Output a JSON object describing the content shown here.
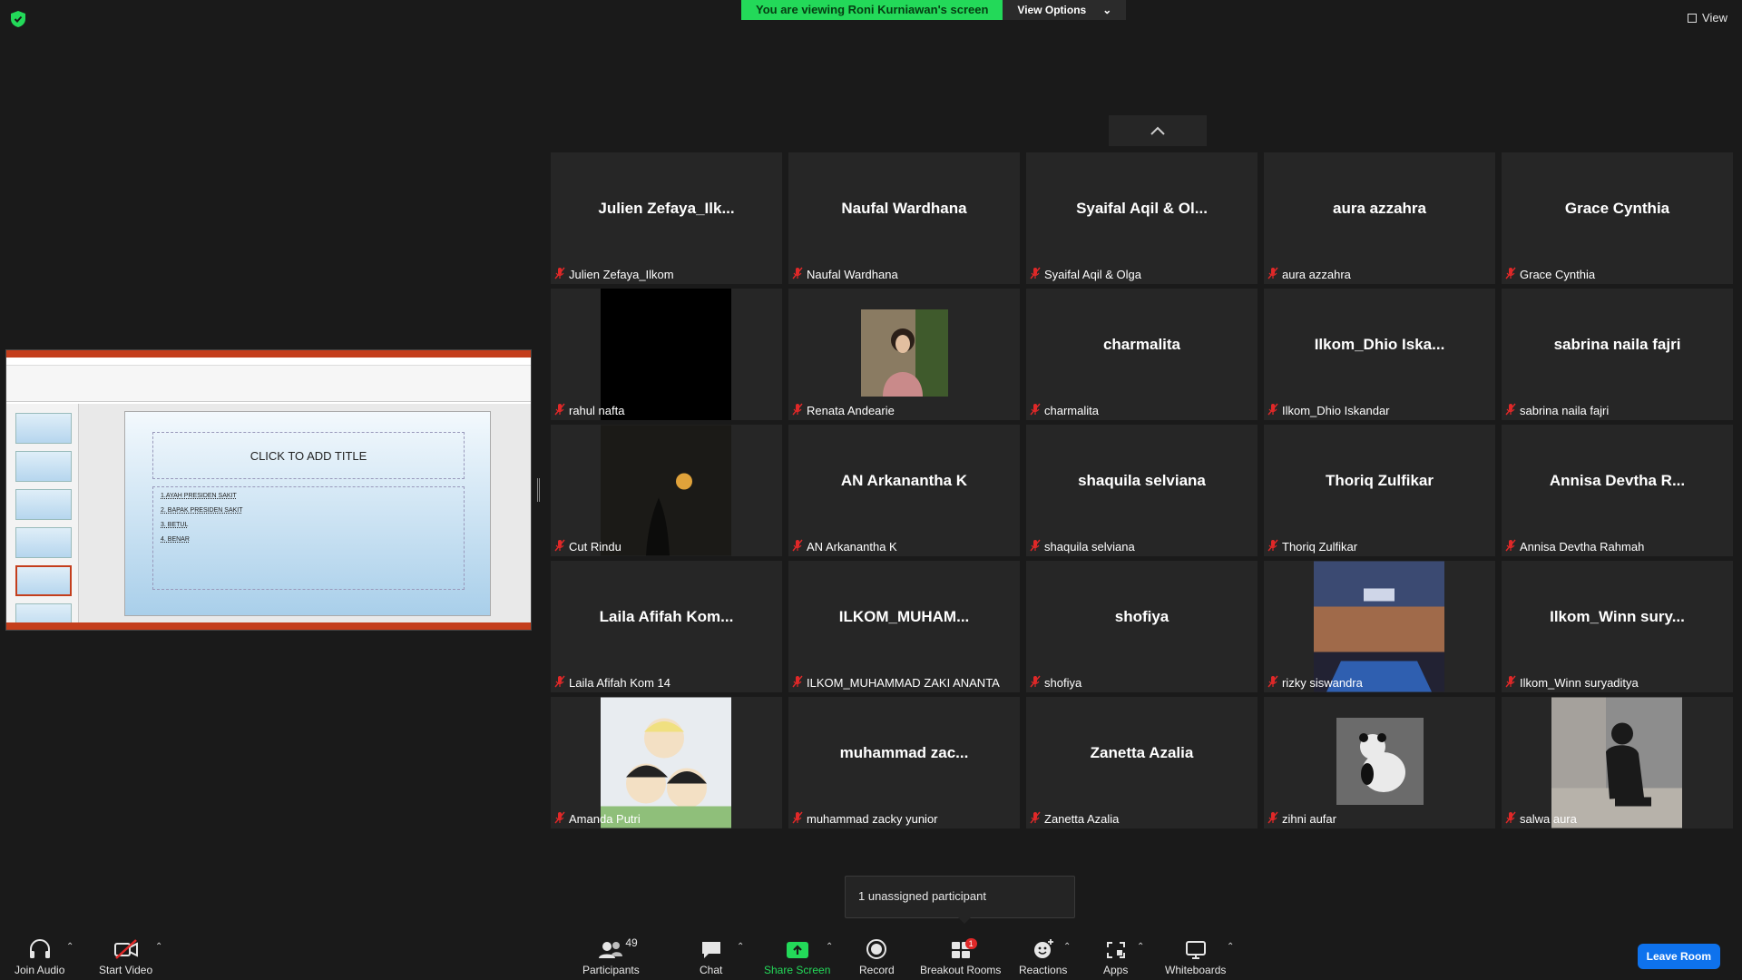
{
  "top": {
    "banner_text": "You are viewing Roni Kurniawan's screen",
    "view_options": "View Options",
    "view_label": "View"
  },
  "shared_screen": {
    "slide_title": "CLICK TO ADD TITLE",
    "bullets": [
      "1.AYAH PRESIDEN SAKIT",
      "2. BAPAK PRESIDEN SAKIT",
      "3. BETUL",
      "4. BENAR"
    ]
  },
  "participants": [
    {
      "big": "Julien  Zefaya_Ilk...",
      "label": "Julien Zefaya_Ilkom"
    },
    {
      "big": "Naufal Wardhana",
      "label": "Naufal Wardhana"
    },
    {
      "big": "Syaifal Aqil & Ol...",
      "label": "Syaifal Aqil & Olga"
    },
    {
      "big": "aura azzahra",
      "label": "aura azzahra"
    },
    {
      "big": "Grace Cynthia",
      "label": "Grace Cynthia"
    },
    {
      "big": "",
      "label": "rahul nafta",
      "media": "black"
    },
    {
      "big": "",
      "label": "Renata Andearie",
      "media": "photo-woman"
    },
    {
      "big": "charmalita",
      "label": "charmalita"
    },
    {
      "big": "Ilkom_Dhio  Iska...",
      "label": "Ilkom_Dhio Iskandar"
    },
    {
      "big": "sabrina naila fajri",
      "label": "sabrina naila fajri"
    },
    {
      "big": "",
      "label": "Cut Rindu",
      "media": "moon"
    },
    {
      "big": "AN Arkanantha K",
      "label": "AN Arkanantha K"
    },
    {
      "big": "shaquila selviana",
      "label": "shaquila selviana"
    },
    {
      "big": "Thoriq Zulfikar",
      "label": "Thoriq Zulfikar"
    },
    {
      "big": "Annisa  Devtha  R...",
      "label": "Annisa Devtha Rahmah"
    },
    {
      "big": "Laila  Afifah  Kom...",
      "label": "Laila Afifah Kom 14"
    },
    {
      "big": "ILKOM_MUHAM...",
      "label": "ILKOM_MUHAMMAD ZAKI ANANTA"
    },
    {
      "big": "shofiya",
      "label": "shofiya"
    },
    {
      "big": "",
      "label": "rizky siswandra",
      "media": "arena"
    },
    {
      "big": "Ilkom_Winn  sury...",
      "label": "Ilkom_Winn suryaditya"
    },
    {
      "big": "",
      "label": "Amanda Putri",
      "media": "cartoon"
    },
    {
      "big": "muhammad  zac...",
      "label": "muhammad zacky yunior"
    },
    {
      "big": "Zanetta Azalia",
      "label": "Zanetta Azalia"
    },
    {
      "big": "",
      "label": "zihni aufar",
      "media": "panda"
    },
    {
      "big": "",
      "label": "salwa aura",
      "media": "person-dark"
    }
  ],
  "popover": {
    "text": "1 unassigned participant"
  },
  "toolbar": {
    "join_audio": "Join Audio",
    "start_video": "Start Video",
    "participants": "Participants",
    "participants_count": "49",
    "chat": "Chat",
    "share_screen": "Share Screen",
    "record": "Record",
    "breakout_rooms": "Breakout Rooms",
    "breakout_badge": "1",
    "reactions": "Reactions",
    "apps": "Apps",
    "whiteboards": "Whiteboards",
    "leave_room": "Leave Room"
  },
  "colors": {
    "share_green": "#23d959",
    "leave_blue": "#0e72ed",
    "mute_red": "#e02828",
    "tile_bg": "#262626"
  }
}
